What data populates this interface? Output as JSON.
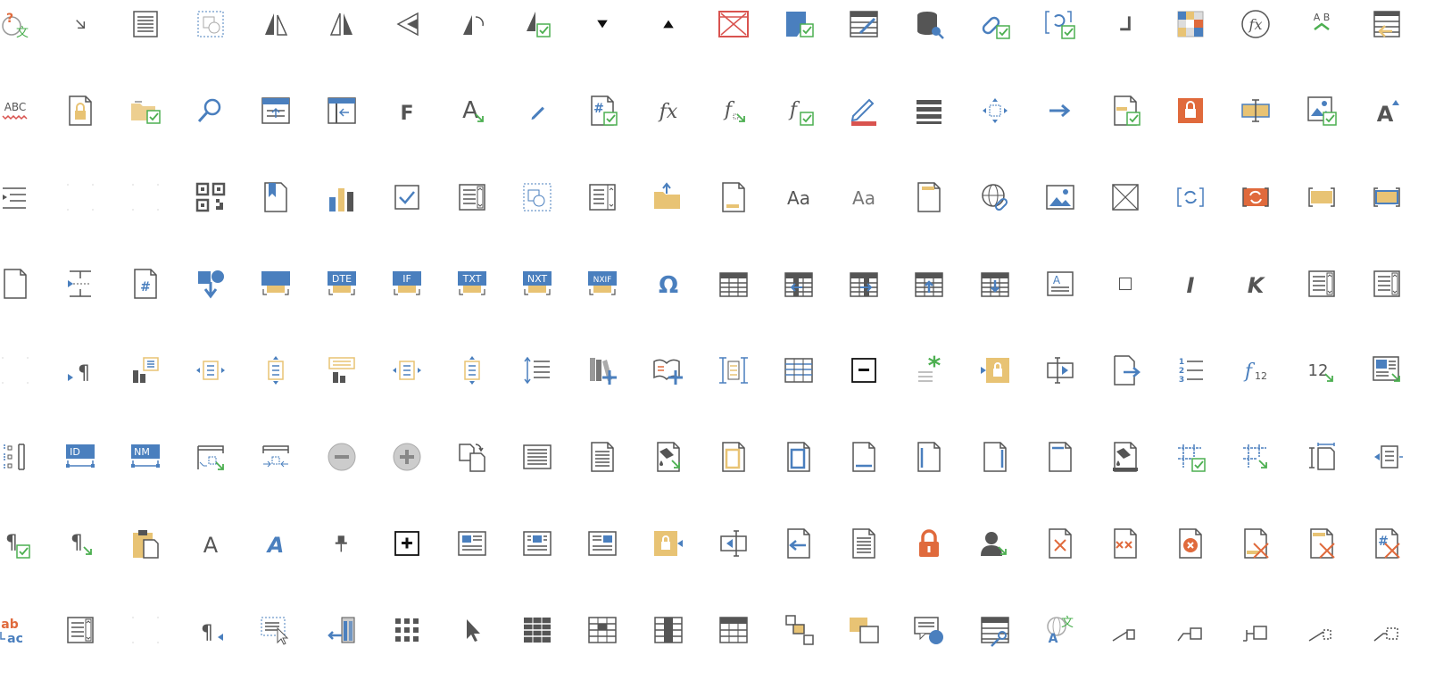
{
  "colors": {
    "blue": "#4a7fbe",
    "green": "#4caf50",
    "gray": "#555555",
    "red": "#d9534f",
    "yellow": "#e8c374",
    "orange": "#e06a3c"
  },
  "rows": [
    [
      {
        "name": "proofing-language-icon",
        "g": "globe-q"
      },
      {
        "name": "resize-arrow-icon",
        "g": "diag-arrow"
      },
      {
        "name": "page-lines-icon",
        "g": "doc-lines"
      },
      {
        "name": "shape-select-icon",
        "g": "dash-box"
      },
      {
        "name": "flip-horizontal-icon",
        "g": "tri-left"
      },
      {
        "name": "mirror-icon",
        "g": "tri-both"
      },
      {
        "name": "rotate-left-icon",
        "g": "tri-point"
      },
      {
        "name": "rotate-shape-icon",
        "g": "tri-curve"
      },
      {
        "name": "flip-check-icon",
        "g": "tri-check"
      },
      {
        "name": "triangle-down-icon",
        "g": "tdown"
      },
      {
        "name": "triangle-up-icon",
        "g": "tup"
      },
      {
        "name": "no-image-icon",
        "g": "cross-box-red"
      },
      {
        "name": "fill-check-icon",
        "g": "blue-shape-check"
      },
      {
        "name": "edit-table-icon",
        "g": "table-pencil"
      },
      {
        "name": "database-key-icon",
        "g": "db"
      },
      {
        "name": "hyperlink-check-icon",
        "g": "link-check"
      },
      {
        "name": "refresh-field-check-icon",
        "g": "brackets-check"
      },
      {
        "name": "corner-icon",
        "g": "corner"
      },
      {
        "name": "color-palette-icon",
        "g": "palette"
      },
      {
        "name": "function-circle-icon",
        "g": "fx-circle"
      },
      {
        "name": "ab-swap-icon",
        "g": "ab"
      },
      {
        "name": "table-export-icon",
        "g": "table-arrow"
      }
    ],
    [
      {
        "name": "spell-check-icon",
        "g": "abc"
      },
      {
        "name": "locked-document-icon",
        "g": "doc-lock"
      },
      {
        "name": "folder-check-icon",
        "g": "folder-check"
      },
      {
        "name": "search-icon",
        "g": "search"
      },
      {
        "name": "header-up-icon",
        "g": "frame-up"
      },
      {
        "name": "column-left-icon",
        "g": "frame-left"
      },
      {
        "name": "bold-f-icon",
        "g": "F"
      },
      {
        "name": "font-style-icon",
        "g": "A-arrow"
      },
      {
        "name": "pencil-icon",
        "g": "pencil"
      },
      {
        "name": "page-number-check-icon",
        "g": "hash-check"
      },
      {
        "name": "function-icon",
        "g": "fx"
      },
      {
        "name": "function-arrow-icon",
        "g": "fx-arrow"
      },
      {
        "name": "function-check-icon",
        "g": "fx-check"
      },
      {
        "name": "highlight-pen-icon",
        "g": "pen-red"
      },
      {
        "name": "list-bars-icon",
        "g": "bars"
      },
      {
        "name": "move-icon",
        "g": "move"
      },
      {
        "name": "arrow-right-icon",
        "g": "arrow-r"
      },
      {
        "name": "page-check-icon",
        "g": "doc-check"
      },
      {
        "name": "lock-orange-icon",
        "g": "lock-orange"
      },
      {
        "name": "text-field-icon",
        "g": "field-cursor"
      },
      {
        "name": "image-check-icon",
        "g": "image-check"
      },
      {
        "name": "font-grow-icon",
        "g": "A-up"
      }
    ],
    [
      {
        "name": "indent-icon",
        "g": "indent"
      },
      {
        "name": "blank-icon",
        "g": "dots"
      },
      {
        "name": "blank-icon-2",
        "g": "dots"
      },
      {
        "name": "qr-code-icon",
        "g": "qr"
      },
      {
        "name": "bookmark-icon",
        "g": "bookmark"
      },
      {
        "name": "bar-chart-icon",
        "g": "chart"
      },
      {
        "name": "checkbox-icon",
        "g": "checkbox"
      },
      {
        "name": "form-list-icon",
        "g": "form-list"
      },
      {
        "name": "shape-dash-icon",
        "g": "dash-shapes"
      },
      {
        "name": "form-scroll-icon",
        "g": "form-scroll"
      },
      {
        "name": "folder-open-icon",
        "g": "folder-open"
      },
      {
        "name": "page-footer-icon",
        "g": "doc-footer"
      },
      {
        "name": "font-case-icon",
        "g": "Aa"
      },
      {
        "name": "font-case-light-icon",
        "g": "Aa2"
      },
      {
        "name": "page-header-icon",
        "g": "doc-header"
      },
      {
        "name": "web-link-icon",
        "g": "globe-link"
      },
      {
        "name": "picture-icon",
        "g": "picture"
      },
      {
        "name": "placeholder-box-icon",
        "g": "cross-box"
      },
      {
        "name": "field-refresh-icon",
        "g": "brackets-refresh"
      },
      {
        "name": "field-refresh-red-icon",
        "g": "brackets-red"
      },
      {
        "name": "field-yellow-icon",
        "g": "brackets-yellow"
      },
      {
        "name": "field-blue-yellow-icon",
        "g": "brackets-blue"
      }
    ],
    [
      {
        "name": "blank-page-icon",
        "g": "doc"
      },
      {
        "name": "page-break-icon",
        "g": "break"
      },
      {
        "name": "page-number-icon",
        "g": "doc-hash"
      },
      {
        "name": "insert-shape-icon",
        "g": "shape-down"
      },
      {
        "name": "field-blue-icon",
        "g": "field-b"
      },
      {
        "name": "date-field-icon",
        "g": "field-DTE"
      },
      {
        "name": "if-field-icon",
        "g": "field-IF"
      },
      {
        "name": "text-field-tag-icon",
        "g": "field-TXT"
      },
      {
        "name": "next-field-icon",
        "g": "field-NXT"
      },
      {
        "name": "nextif-field-icon",
        "g": "field-NXIF"
      },
      {
        "name": "omega-symbol-icon",
        "g": "omega"
      },
      {
        "name": "table-icon",
        "g": "table"
      },
      {
        "name": "table-insert-left-icon",
        "g": "table-l"
      },
      {
        "name": "table-insert-right-icon",
        "g": "table-r"
      },
      {
        "name": "table-insert-above-icon",
        "g": "table-u"
      },
      {
        "name": "table-insert-below-icon",
        "g": "table-d"
      },
      {
        "name": "text-box-icon",
        "g": "textbox-A"
      },
      {
        "name": "square-icon",
        "g": "square"
      },
      {
        "name": "italic-icon",
        "g": "I"
      },
      {
        "name": "italic-k-icon",
        "g": "K"
      },
      {
        "name": "form-list-2-icon",
        "g": "form-list"
      },
      {
        "name": "form-list-3-icon",
        "g": "form-list"
      }
    ],
    [
      {
        "name": "blank-icon-3",
        "g": "dots"
      },
      {
        "name": "paragraph-arrow-icon",
        "g": "para-arrow"
      },
      {
        "name": "chart-list-icon",
        "g": "chart-list"
      },
      {
        "name": "list-horizontal-icon",
        "g": "list-h"
      },
      {
        "name": "list-vertical-icon",
        "g": "list-v"
      },
      {
        "name": "chart-yellow-icon",
        "g": "chart-yellow"
      },
      {
        "name": "list-horizontal-2-icon",
        "g": "list-h"
      },
      {
        "name": "list-vertical-2-icon",
        "g": "list-v"
      },
      {
        "name": "line-spacing-icon",
        "g": "spacing"
      },
      {
        "name": "add-books-icon",
        "g": "books"
      },
      {
        "name": "open-book-add-icon",
        "g": "book-add"
      },
      {
        "name": "column-bracket-icon",
        "g": "col-bracket"
      },
      {
        "name": "grid-table-icon",
        "g": "grid-table"
      },
      {
        "name": "collapse-box-icon",
        "g": "minus-box"
      },
      {
        "name": "asterisk-list-icon",
        "g": "asterisk"
      },
      {
        "name": "lock-field-icon",
        "g": "lock-field"
      },
      {
        "name": "text-cursor-field-icon",
        "g": "field-play"
      },
      {
        "name": "export-page-icon",
        "g": "doc-export"
      },
      {
        "name": "numbered-list-icon",
        "g": "numlist"
      },
      {
        "name": "function-12-icon",
        "g": "f12"
      },
      {
        "name": "number-arrow-icon",
        "g": "n12"
      },
      {
        "name": "image-arrow-icon",
        "g": "image-arrow"
      }
    ],
    [
      {
        "name": "align-left-bracket-icon",
        "g": "align-l"
      },
      {
        "name": "id-field-icon",
        "g": "field-ID"
      },
      {
        "name": "nm-field-icon",
        "g": "field-NM"
      },
      {
        "name": "header-arrow-icon",
        "g": "header-arrow"
      },
      {
        "name": "header-center-icon",
        "g": "header-center"
      },
      {
        "name": "remove-circle-icon",
        "g": "circle-minus"
      },
      {
        "name": "add-circle-icon",
        "g": "circle-plus"
      },
      {
        "name": "duplicate-page-icon",
        "g": "dup"
      },
      {
        "name": "document-text-icon",
        "g": "doc-text"
      },
      {
        "name": "document-lines-icon",
        "g": "doc-lines2"
      },
      {
        "name": "fill-page-icon",
        "g": "doc-fill"
      },
      {
        "name": "page-border-yellow-icon",
        "g": "doc-yellow"
      },
      {
        "name": "page-border-blue-icon",
        "g": "doc-blue"
      },
      {
        "name": "page-border-bottom-icon",
        "g": "doc-bottom"
      },
      {
        "name": "page-border-left-icon",
        "g": "doc-left"
      },
      {
        "name": "page-border-right-icon",
        "g": "doc-right"
      },
      {
        "name": "page-border-top-icon",
        "g": "doc-top"
      },
      {
        "name": "fill-bucket-icon",
        "g": "bucket"
      },
      {
        "name": "table-check-icon",
        "g": "table-check"
      },
      {
        "name": "table-arrow-icon",
        "g": "table-ar"
      },
      {
        "name": "text-bracket-icon",
        "g": "text-bracket"
      },
      {
        "name": "field-left-arrow-icon",
        "g": "field-left"
      }
    ],
    [
      {
        "name": "paragraph-check-icon",
        "g": "para-check"
      },
      {
        "name": "paragraph-arrow-2-icon",
        "g": "para-arrow2"
      },
      {
        "name": "paste-icon",
        "g": "clipboard"
      },
      {
        "name": "font-a-icon",
        "g": "A-light"
      },
      {
        "name": "font-a-blue-icon",
        "g": "A-blue"
      },
      {
        "name": "pin-icon",
        "g": "pin"
      },
      {
        "name": "expand-box-icon",
        "g": "plus-box"
      },
      {
        "name": "newspaper-icon",
        "g": "news"
      },
      {
        "name": "newspaper-center-icon",
        "g": "news2"
      },
      {
        "name": "newspaper-right-icon",
        "g": "news3"
      },
      {
        "name": "lock-arrow-icon",
        "g": "lock-arrow"
      },
      {
        "name": "field-arrow-left-icon",
        "g": "field-arr"
      },
      {
        "name": "import-page-icon",
        "g": "doc-import"
      },
      {
        "name": "document-icon",
        "g": "doc-text2"
      },
      {
        "name": "lock-red-icon",
        "g": "lock-red"
      },
      {
        "name": "user-arrow-icon",
        "g": "user"
      },
      {
        "name": "delete-page-icon",
        "g": "doc-x"
      },
      {
        "name": "delete-fields-icon",
        "g": "doc-xx"
      },
      {
        "name": "delete-circle-page-icon",
        "g": "doc-xcircle"
      },
      {
        "name": "delete-footer-icon",
        "g": "doc-xbottom"
      },
      {
        "name": "delete-header-icon",
        "g": "doc-xtop"
      },
      {
        "name": "delete-number-icon",
        "g": "doc-xhash"
      }
    ],
    [
      {
        "name": "autocorrect-icon",
        "g": "abac"
      },
      {
        "name": "form-list-4-icon",
        "g": "form-list"
      },
      {
        "name": "blank-icon-4",
        "g": "dots"
      },
      {
        "name": "paragraph-left-icon",
        "g": "para-left"
      },
      {
        "name": "select-cursor-icon",
        "g": "select-cursor"
      },
      {
        "name": "insert-column-icon",
        "g": "ins-col"
      },
      {
        "name": "grid-dots-icon",
        "g": "dotgrid"
      },
      {
        "name": "pointer-icon",
        "g": "pointer"
      },
      {
        "name": "table-dark-icon",
        "g": "table-dark"
      },
      {
        "name": "table-center-row-icon",
        "g": "table-c"
      },
      {
        "name": "table-center-column-icon",
        "g": "table-cc"
      },
      {
        "name": "table-header-row-icon",
        "g": "table-h"
      },
      {
        "name": "align-objects-icon",
        "g": "align-obj"
      },
      {
        "name": "send-back-icon",
        "g": "send-back"
      },
      {
        "name": "comment-shape-icon",
        "g": "comment"
      },
      {
        "name": "table-key-icon",
        "g": "table-key"
      },
      {
        "name": "translate-icon",
        "g": "translate"
      },
      {
        "name": "shape-callout-icon",
        "g": "callout1"
      },
      {
        "name": "shape-callout-2-icon",
        "g": "callout2"
      },
      {
        "name": "shape-callout-3-icon",
        "g": "callout3"
      },
      {
        "name": "shape-callout-dash-icon",
        "g": "callout4"
      },
      {
        "name": "shape-callout-dash-2-icon",
        "g": "callout5"
      }
    ]
  ],
  "labels": {
    "abc": "ABC",
    "F": "F",
    "fx": "fx",
    "Aa": "Aa",
    "I": "I",
    "K": "K",
    "DTE": "DTE",
    "IF": "IF",
    "TXT": "TXT",
    "NXT": "NXT",
    "NXIF": "NXIF",
    "ID": "ID",
    "NM": "NM",
    "omega": "Ω",
    "ab_top": "A B",
    "f12": "12",
    "n12": "12",
    "abac_top": "ab",
    "abac_bot": "ac",
    "translate_a": "A",
    "translate_zh": "文",
    "q": "?",
    "para": "¶",
    "hash": "#",
    "num1": "1",
    "num2": "2",
    "num3": "3"
  }
}
